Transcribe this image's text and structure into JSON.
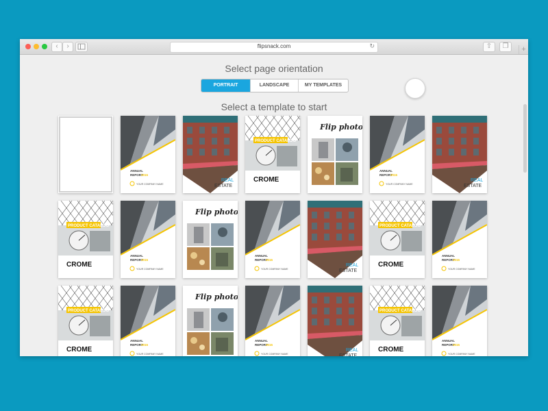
{
  "browser": {
    "url": "flipsnack.com",
    "back_glyph": "‹",
    "forward_glyph": "›",
    "reload_glyph": "↻",
    "share_glyph": "⇧",
    "tabs_glyph": "❐",
    "plus_glyph": "+"
  },
  "page": {
    "orientation_title": "Select page orientation",
    "template_title": "Select a template to start",
    "tabs": [
      {
        "label": "PORTRAIT",
        "active": true
      },
      {
        "label": "LANDSCAPE",
        "active": false
      },
      {
        "label": "MY TEMPLATES",
        "active": false
      }
    ]
  },
  "colors": {
    "background": "#0a9ac0",
    "accent": "#1aa6df",
    "catalog_yellow": "#f5c400",
    "estate_blue": "#1aa6df"
  },
  "templates": {
    "rows": [
      [
        "blank",
        "annual",
        "estate",
        "catalog",
        "flip",
        "annual",
        "estate"
      ],
      [
        "catalog",
        "annual",
        "flip",
        "annual",
        "estate",
        "catalog",
        "annual"
      ],
      [
        "catalog",
        "annual",
        "flip",
        "annual",
        "estate",
        "catalog",
        "annual"
      ]
    ],
    "text": {
      "catalog_title": "PRODUCT CATALOG",
      "catalog_name": "CROME",
      "annual_title": "ANNUAL",
      "annual_sub": "REPORT",
      "annual_year": "2015",
      "annual_company": "YOUR COMPANY NAME",
      "flip_title": "Flip photos",
      "estate_line1": "REAL",
      "estate_line2": "ESTATE"
    }
  }
}
